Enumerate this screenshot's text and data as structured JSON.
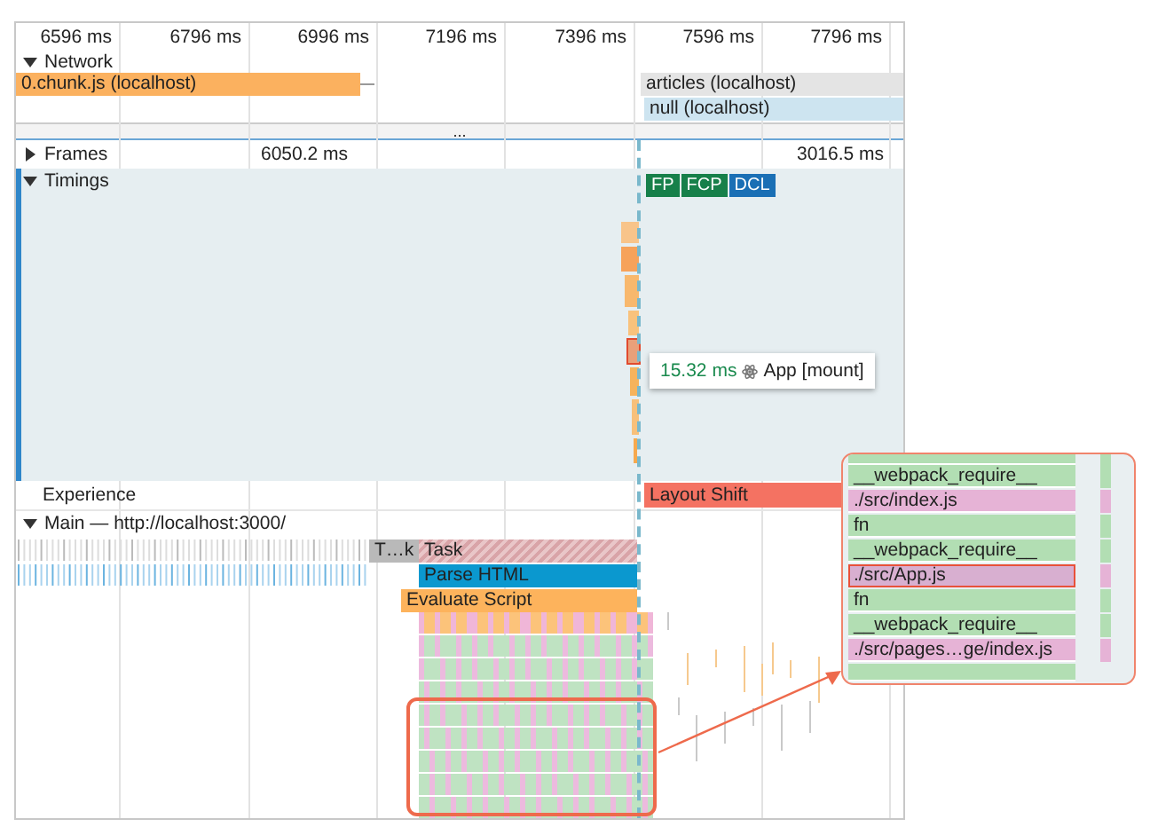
{
  "ruler": {
    "ticks": [
      "6596 ms",
      "6796 ms",
      "6996 ms",
      "7196 ms",
      "7396 ms",
      "7596 ms",
      "7796 ms"
    ]
  },
  "network": {
    "label": "Network",
    "expanded": true,
    "requests": [
      {
        "name": "0.chunk.js (localhost)",
        "kind": "script"
      },
      {
        "name": "articles (localhost)",
        "kind": "fetch"
      },
      {
        "name": "null (localhost)",
        "kind": "other"
      }
    ]
  },
  "more": "...",
  "frames": {
    "label": "Frames",
    "expanded": false,
    "durations": [
      "6050.2 ms",
      "3016.5 ms"
    ]
  },
  "timings": {
    "label": "Timings",
    "expanded": true,
    "markers": [
      {
        "label": "FP",
        "color": "#17804a"
      },
      {
        "label": "FCP",
        "color": "#17804a"
      },
      {
        "label": "DCL",
        "color": "#1a6fb5"
      }
    ],
    "tooltip": {
      "duration": "15.32 ms",
      "label": "App [mount]"
    }
  },
  "experience": {
    "label": "Experience",
    "event": "Layout Shift"
  },
  "main": {
    "label": "Main — http://localhost:3000/",
    "expanded": true,
    "events": [
      {
        "name": "T…k",
        "kind": "task"
      },
      {
        "name": "Task",
        "kind": "long-task"
      },
      {
        "name": "Parse HTML",
        "kind": "parse"
      },
      {
        "name": "Evaluate Script",
        "kind": "script"
      }
    ]
  },
  "callout": {
    "frames": [
      {
        "name": "__webpack_require__",
        "kind": "function",
        "selected": false
      },
      {
        "name": "./src/index.js",
        "kind": "module",
        "selected": false
      },
      {
        "name": "fn",
        "kind": "function",
        "selected": false
      },
      {
        "name": "__webpack_require__",
        "kind": "function",
        "selected": false
      },
      {
        "name": "./src/App.js",
        "kind": "module",
        "selected": true
      },
      {
        "name": "fn",
        "kind": "function",
        "selected": false
      },
      {
        "name": "__webpack_require__",
        "kind": "function",
        "selected": false
      },
      {
        "name": "./src/pages…ge/index.js",
        "kind": "module",
        "selected": false
      }
    ]
  }
}
